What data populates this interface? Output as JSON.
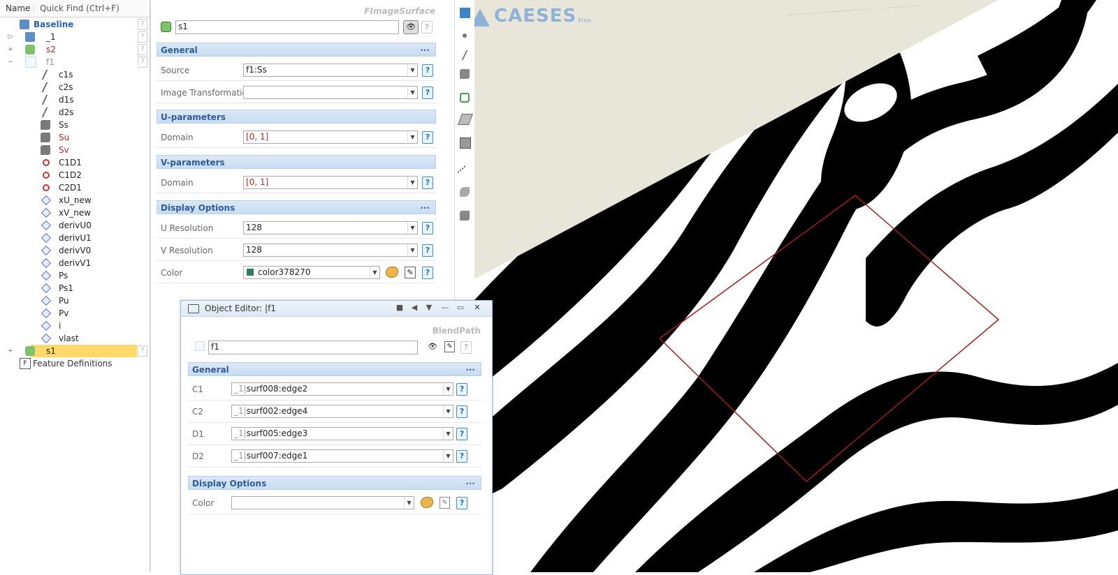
{
  "tree": {
    "header": {
      "name": "Name",
      "quick_find": "Quick Find (Ctrl+F)"
    },
    "items": [
      {
        "label": "Baseline",
        "icon": "folder-icon",
        "color": "#2a63b0",
        "bold": true,
        "expander": "◢"
      },
      {
        "label": "_1",
        "icon": "folder-icon",
        "color": "#222",
        "expander": "▷"
      },
      {
        "label": "s2",
        "icon": "image-surface-icon",
        "color": "#b22",
        "expander": "+"
      },
      {
        "label": "f1",
        "icon": "blend-path-icon",
        "color": "#999",
        "expander": "−"
      },
      {
        "label": "c1s",
        "icon": "curve-icon",
        "color": "#222"
      },
      {
        "label": "c2s",
        "icon": "curve-icon",
        "color": "#222"
      },
      {
        "label": "d1s",
        "icon": "curve-icon",
        "color": "#222"
      },
      {
        "label": "d2s",
        "icon": "curve-icon",
        "color": "#222"
      },
      {
        "label": "Ss",
        "icon": "surface-icon",
        "color": "#222"
      },
      {
        "label": "Su",
        "icon": "surface-icon",
        "color": "#b22"
      },
      {
        "label": "Sv",
        "icon": "surface-icon",
        "color": "#b22"
      },
      {
        "label": "C1D1",
        "icon": "point-icon",
        "color": "#222"
      },
      {
        "label": "C1D2",
        "icon": "point-icon",
        "color": "#222"
      },
      {
        "label": "C2D1",
        "icon": "point-icon",
        "color": "#222"
      },
      {
        "label": "xU_new",
        "icon": "parameter-icon",
        "color": "#222"
      },
      {
        "label": "xV_new",
        "icon": "parameter-icon",
        "color": "#222"
      },
      {
        "label": "derivU0",
        "icon": "parameter-icon",
        "color": "#222"
      },
      {
        "label": "derivU1",
        "icon": "parameter-icon",
        "color": "#222"
      },
      {
        "label": "derivV0",
        "icon": "parameter-icon",
        "color": "#222"
      },
      {
        "label": "derivV1",
        "icon": "parameter-icon",
        "color": "#222"
      },
      {
        "label": "Ps",
        "icon": "parameter-icon",
        "color": "#222"
      },
      {
        "label": "Ps1",
        "icon": "parameter-icon",
        "color": "#222"
      },
      {
        "label": "Pu",
        "icon": "parameter-icon",
        "color": "#222"
      },
      {
        "label": "Pv",
        "icon": "parameter-icon",
        "color": "#222"
      },
      {
        "label": "i",
        "icon": "parameter-icon",
        "color": "#222"
      },
      {
        "label": "vlast",
        "icon": "parameter-icon",
        "color": "#222"
      },
      {
        "label": "s1",
        "icon": "image-surface-icon",
        "color": "#222",
        "selected": true,
        "expander": "+"
      },
      {
        "label": "Feature Definitions",
        "icon": "feature-icon",
        "color": "#333",
        "expander": "▷"
      }
    ],
    "help_glyph": "?"
  },
  "props": {
    "type_label": "FImageSurface",
    "name_value": "s1",
    "sections": {
      "general": "General",
      "u_params": "U-parameters",
      "v_params": "V-parameters",
      "display": "Display Options",
      "dots": "···"
    },
    "fields": {
      "source_label": "Source",
      "source_value": "f1:Ss",
      "transform_label": "Image Transformation",
      "transform_value": "",
      "u_domain_label": "Domain",
      "u_domain_value": "[0, 1]",
      "v_domain_label": "Domain",
      "v_domain_value": "[0, 1]",
      "u_res_label": "U Resolution",
      "u_res_value": "128",
      "v_res_label": "V Resolution",
      "v_res_value": "128",
      "color_label": "Color",
      "color_value": "color378270",
      "color_swatch": "#2e7d5b"
    }
  },
  "object_editor": {
    "title": "Object Editor: |f1",
    "type_label": "BlendPath",
    "name_value": "f1",
    "general": "General",
    "display": "Display Options",
    "dots": "···",
    "rows": [
      {
        "label": "C1",
        "prefix": "_1|",
        "value": "surf008:edge2"
      },
      {
        "label": "C2",
        "prefix": "_1|",
        "value": "surf002:edge4"
      },
      {
        "label": "D1",
        "prefix": "_1|",
        "value": "surf005:edge3"
      },
      {
        "label": "D2",
        "prefix": "_1|",
        "value": "surf007:edge1"
      }
    ],
    "color_label": "Color",
    "color_value": "",
    "window_buttons": [
      "■",
      "◀",
      "▼",
      "—",
      "▭",
      "✕"
    ]
  },
  "viewport": {
    "logo_text": "CAESES",
    "logo_suffix": "Free",
    "background": "#e8e6d9",
    "logo_color": "#8fb2d6"
  },
  "common": {
    "help": "?",
    "arrow": "▼"
  }
}
